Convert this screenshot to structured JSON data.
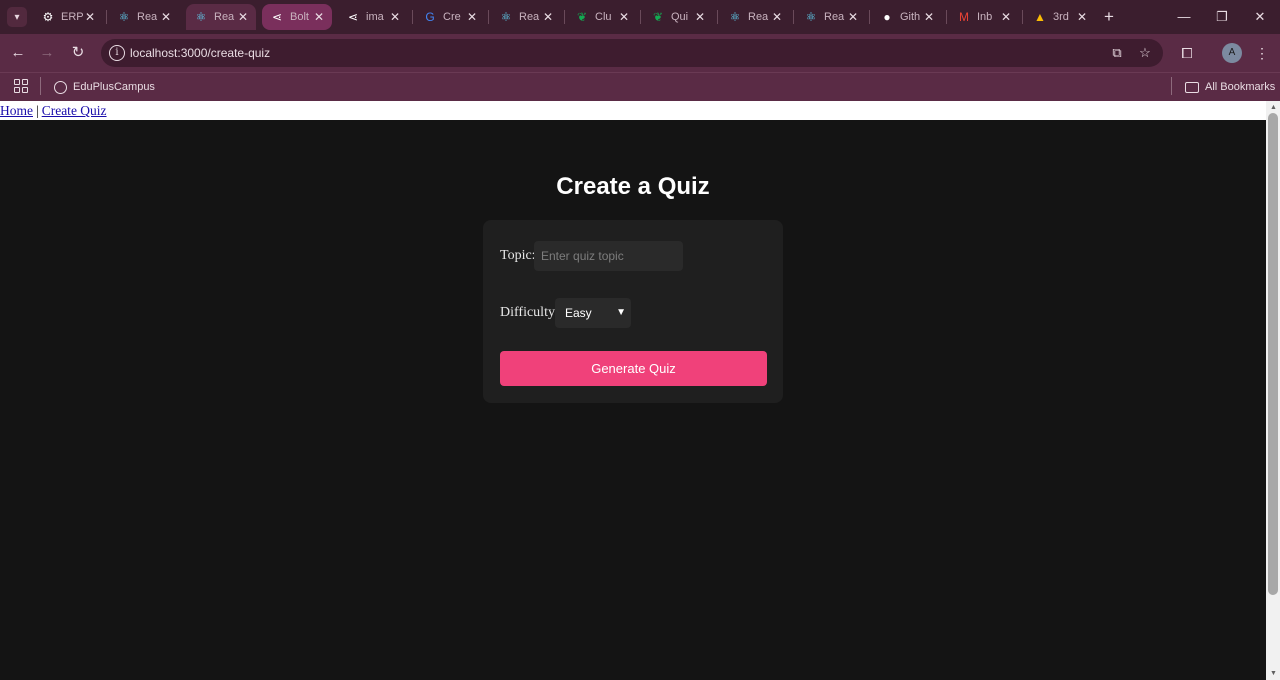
{
  "browser": {
    "tabs": [
      {
        "title": "ERP",
        "icon": "gear-icon",
        "color": "#ffffff"
      },
      {
        "title": "Rea",
        "icon": "react-icon",
        "color": "#61dafb"
      },
      {
        "title": "Rea",
        "icon": "react-icon",
        "color": "#61dafb"
      },
      {
        "title": "Bolt",
        "icon": "share-icon",
        "color": "#ffffff"
      },
      {
        "title": "ima",
        "icon": "share-icon",
        "color": "#ffffff"
      },
      {
        "title": "Cre",
        "icon": "google-icon",
        "color": "#4285f4"
      },
      {
        "title": "Rea",
        "icon": "react-icon",
        "color": "#61dafb"
      },
      {
        "title": "Clu",
        "icon": "mongodb-icon",
        "color": "#13aa52"
      },
      {
        "title": "Qui",
        "icon": "mongodb-icon",
        "color": "#13aa52"
      },
      {
        "title": "Rea",
        "icon": "react-icon",
        "color": "#61dafb"
      },
      {
        "title": "Rea",
        "icon": "react-icon",
        "color": "#61dafb"
      },
      {
        "title": "Gith",
        "icon": "github-icon",
        "color": "#ffffff"
      },
      {
        "title": "Inb",
        "icon": "gmail-icon",
        "color": "#ea4335"
      },
      {
        "title": "3rd",
        "icon": "drive-icon",
        "color": "#fbbc04"
      }
    ],
    "url": "localhost:3000/create-quiz",
    "bookmark": "EduPlusCampus",
    "all_bookmarks": "All Bookmarks",
    "avatar_letter": "A"
  },
  "nav": {
    "home": "Home",
    "separator": "|",
    "create_quiz": "Create Quiz"
  },
  "page": {
    "title": "Create a Quiz",
    "topic_label": "Topic:",
    "topic_placeholder": "Enter quiz topic",
    "difficulty_label": "Difficulty:",
    "difficulty_value": "Easy",
    "generate_button": "Generate Quiz"
  },
  "colors": {
    "accent": "#f0417a",
    "page_bg": "#141414",
    "card_bg": "#1f1f1f",
    "chrome": "#5a2b45"
  }
}
